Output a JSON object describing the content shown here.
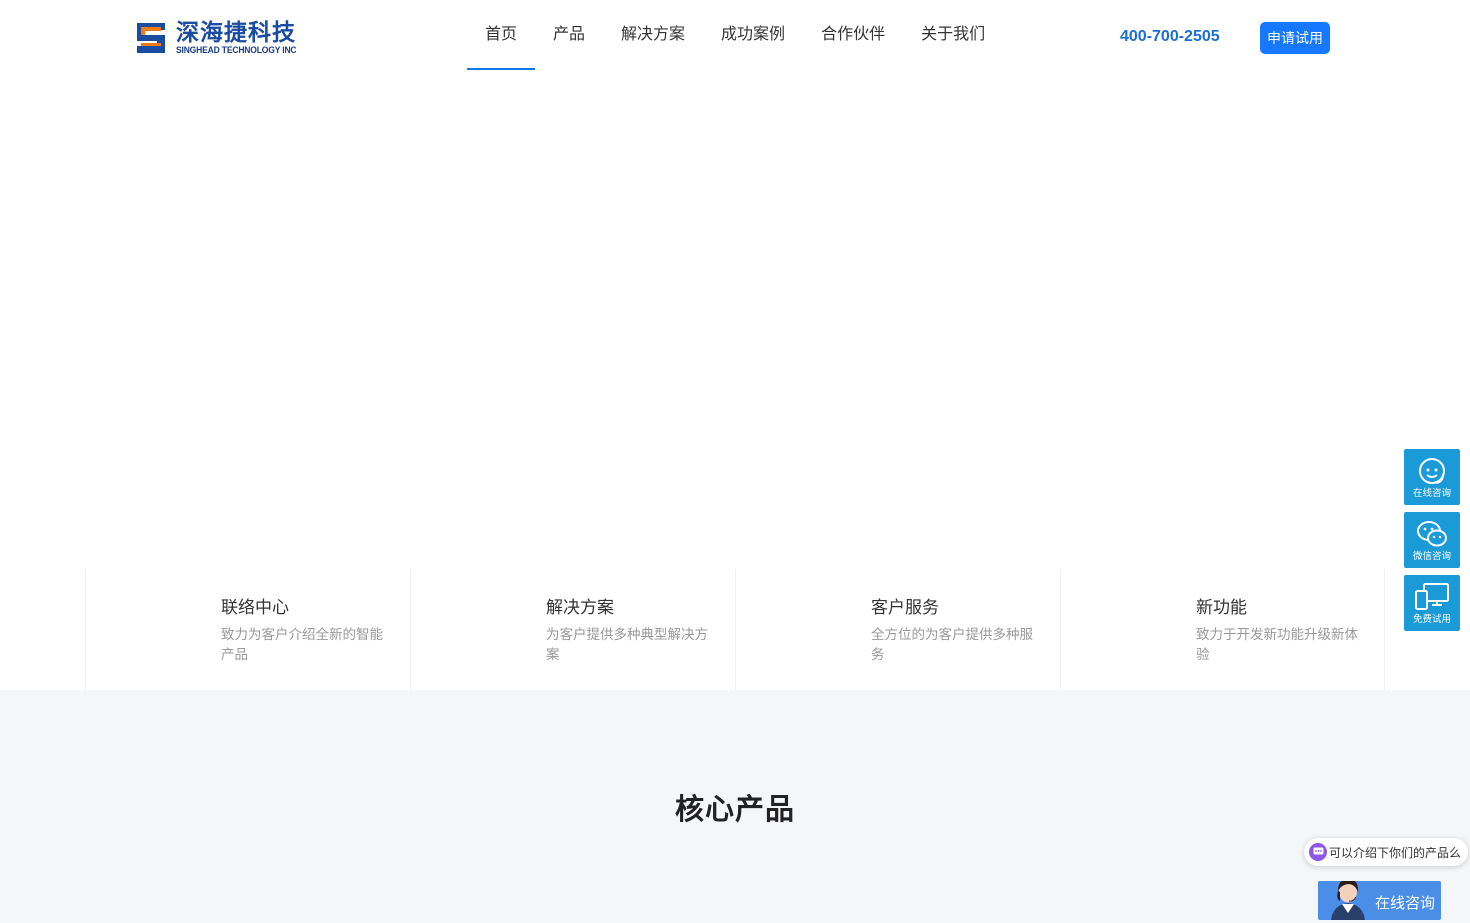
{
  "header": {
    "logo": {
      "cn": "深海捷科技",
      "en": "SINGHEAD TECHNOLOGY INC"
    },
    "nav": [
      {
        "label": "首页",
        "active": true
      },
      {
        "label": "产品",
        "active": false
      },
      {
        "label": "解决方案",
        "active": false
      },
      {
        "label": "成功案例",
        "active": false
      },
      {
        "label": "合作伙伴",
        "active": false
      },
      {
        "label": "关于我们",
        "active": false
      }
    ],
    "phone": "400-700-2505",
    "trial_button": "申请试用"
  },
  "features": [
    {
      "title": "联络中心",
      "desc": "致力为客户介绍全新的智能产品"
    },
    {
      "title": "解决方案",
      "desc": "为客户提供多种典型解决方案"
    },
    {
      "title": "客户服务",
      "desc": "全方位的为客户提供多种服务"
    },
    {
      "title": "新功能",
      "desc": "致力于开发新功能升级新体验"
    }
  ],
  "core_products": {
    "title": "核心产品"
  },
  "float_bar": [
    {
      "label": "在线咨询",
      "icon": "headset-icon"
    },
    {
      "label": "微信咨询",
      "icon": "wechat-icon"
    },
    {
      "label": "免费试用",
      "icon": "devices-icon"
    }
  ],
  "chat": {
    "bubble_text": "可以介绍下你们的产品么",
    "consult_label": "在线咨询"
  },
  "colors": {
    "accent": "#1677ff",
    "phone": "#1a6fd6",
    "float_bar": "#1a9bd7",
    "section_bg": "#f5f6f8"
  }
}
